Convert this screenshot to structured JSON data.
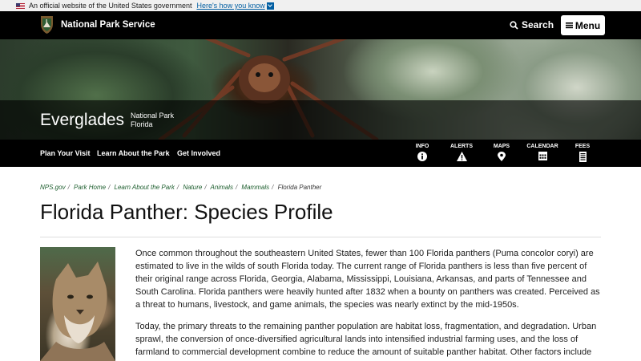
{
  "gov_banner": {
    "text": "An official website of the United States government",
    "link": "Here's how you know"
  },
  "header": {
    "site_title": "National Park Service",
    "search_label": "Search",
    "menu_label": "Menu"
  },
  "park": {
    "name": "Everglades",
    "type_line1": "National Park",
    "type_line2": "Florida"
  },
  "nav": {
    "links": [
      "Plan Your Visit",
      "Learn About the Park",
      "Get Involved"
    ],
    "tools": [
      {
        "label": "INFO",
        "icon": "info-icon"
      },
      {
        "label": "ALERTS",
        "icon": "alert-icon"
      },
      {
        "label": "MAPS",
        "icon": "map-pin-icon"
      },
      {
        "label": "CALENDAR",
        "icon": "calendar-icon"
      },
      {
        "label": "FEES",
        "icon": "fees-icon"
      }
    ]
  },
  "breadcrumb": {
    "items": [
      "NPS.gov",
      "Park Home",
      "Learn About the Park",
      "Nature",
      "Animals",
      "Mammals"
    ],
    "current": "Florida Panther"
  },
  "page": {
    "title": "Florida Panther: Species Profile",
    "paragraph1": "Once common throughout the southeastern United States, fewer than 100 Florida panthers (Puma concolor coryi) are estimated to live in the wilds of south Florida today. The current range of Florida panthers is less than five percent of their original range across Florida, Georgia, Alabama, Mississippi, Louisiana, Arkansas, and parts of Tennessee and South Carolina. Florida panthers were heavily hunted after 1832 when a bounty on panthers was created. Perceived as a threat to humans, livestock, and game animals, the species was nearly extinct by the mid-1950s.",
    "paragraph2": "Today, the primary threats to the remaining panther population are habitat loss, fragmentation, and degradation. Urban sprawl, the conversion of once-diversified agricultural lands into intensified industrial farming uses, and the loss of farmland to commercial development combine to reduce the amount of suitable panther habitat. Other factors include"
  },
  "colors": {
    "header_bg": "#000000",
    "link_green": "#1d5e2e",
    "gov_link": "#005ea2"
  }
}
